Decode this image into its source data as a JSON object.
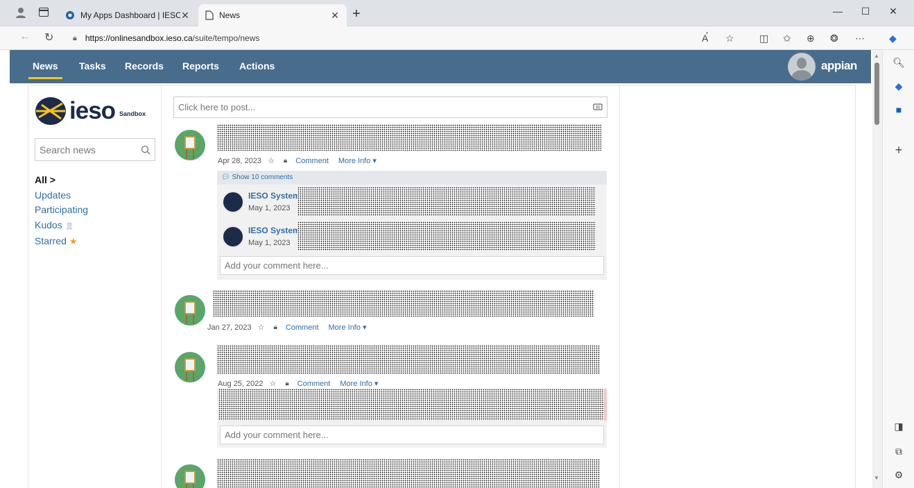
{
  "browser": {
    "tabs": [
      {
        "title": "My Apps Dashboard | IESO Gate",
        "active": false
      },
      {
        "title": "News",
        "active": true
      }
    ],
    "url_host": "https://onlinesandbox.ieso.ca",
    "url_path": "/suite/tempo/news"
  },
  "appnav": {
    "items": [
      "News",
      "Tasks",
      "Records",
      "Reports",
      "Actions"
    ],
    "active": "News",
    "brand": "appian"
  },
  "sidebar": {
    "logo_text": "ieso",
    "logo_tag": "Sandbox",
    "search_placeholder": "Search news",
    "filters": [
      "All >",
      "Updates",
      "Participating",
      "Kudos",
      "Starred"
    ],
    "selected_filter": "All >"
  },
  "feed": {
    "post_placeholder": "Click here to post...",
    "comment_placeholder": "Add your comment here...",
    "comment_label": "Comment",
    "more_info_label": "More Info",
    "show_comments_label": "Show 10 comments",
    "posts": [
      {
        "date": "Apr 28, 2023",
        "comments": [
          {
            "author": "IESO System",
            "date": "May 1, 2023"
          },
          {
            "author": "IESO System",
            "date": "May 1, 2023"
          }
        ]
      },
      {
        "date": "Jan 27, 2023"
      },
      {
        "date": "Aug 25, 2022"
      }
    ]
  },
  "colors": {
    "nav_bg": "#486d8c",
    "accent": "#f5c518",
    "link": "#2f6ea6"
  }
}
